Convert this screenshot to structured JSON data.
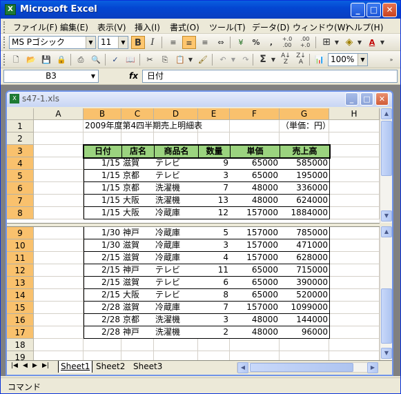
{
  "app": {
    "title": "Microsoft Excel"
  },
  "menubar": {
    "items": [
      "ファイル(F)",
      "編集(E)",
      "表示(V)",
      "挿入(I)",
      "書式(O)",
      "ツール(T)",
      "データ(D)",
      "ウィンドウ(W)",
      "ヘルプ(H)"
    ]
  },
  "format_toolbar": {
    "font_name": "MS Pゴシック",
    "font_size": "11",
    "bold_label": "B",
    "italic_label": "I",
    "percent_label": "%",
    "comma_label": ",",
    "inc_dec_label": "+.0 .00",
    "dec_dec_label": ".00 +.0"
  },
  "standard_toolbar": {
    "zoom": "100%",
    "sum_label": "Σ"
  },
  "formula_bar": {
    "name_box": "B3",
    "fx_label": "fx",
    "content": "日付"
  },
  "workbook": {
    "title": "s47-1.xls"
  },
  "columns": [
    "A",
    "B",
    "C",
    "D",
    "E",
    "F",
    "G",
    "H"
  ],
  "row_numbers_top": [
    "1",
    "2",
    "3",
    "4",
    "5",
    "6",
    "7",
    "8"
  ],
  "row_numbers_bottom": [
    "9",
    "10",
    "11",
    "12",
    "13",
    "14",
    "15",
    "16",
    "17",
    "18",
    "19"
  ],
  "sheet": {
    "title_cell": "2009年度第4四半期売上明細表",
    "unit_cell": "（単価：円）",
    "headers": [
      "日付",
      "店名",
      "商品名",
      "数量",
      "単価",
      "売上高"
    ],
    "rows_top": [
      [
        "1/15",
        "滋賀",
        "テレビ",
        "9",
        "65000",
        "585000"
      ],
      [
        "1/15",
        "京都",
        "テレビ",
        "3",
        "65000",
        "195000"
      ],
      [
        "1/15",
        "京都",
        "洗濯機",
        "7",
        "48000",
        "336000"
      ],
      [
        "1/15",
        "大阪",
        "洗濯機",
        "13",
        "48000",
        "624000"
      ],
      [
        "1/15",
        "大阪",
        "冷蔵庫",
        "12",
        "157000",
        "1884000"
      ]
    ],
    "rows_bottom": [
      [
        "1/30",
        "神戸",
        "冷蔵庫",
        "5",
        "157000",
        "785000"
      ],
      [
        "1/30",
        "滋賀",
        "冷蔵庫",
        "3",
        "157000",
        "471000"
      ],
      [
        "2/15",
        "滋賀",
        "冷蔵庫",
        "4",
        "157000",
        "628000"
      ],
      [
        "2/15",
        "神戸",
        "テレビ",
        "11",
        "65000",
        "715000"
      ],
      [
        "2/15",
        "滋賀",
        "テレビ",
        "6",
        "65000",
        "390000"
      ],
      [
        "2/15",
        "大阪",
        "テレビ",
        "8",
        "65000",
        "520000"
      ],
      [
        "2/28",
        "滋賀",
        "冷蔵庫",
        "7",
        "157000",
        "1099000"
      ],
      [
        "2/28",
        "京都",
        "洗濯機",
        "3",
        "48000",
        "144000"
      ],
      [
        "2/28",
        "神戸",
        "洗濯機",
        "2",
        "48000",
        "96000"
      ]
    ]
  },
  "sheet_tabs": [
    "Sheet1",
    "Sheet2",
    "Sheet3"
  ],
  "status": {
    "mode": "コマンド"
  },
  "colors": {
    "selection_header": "#f9c16d",
    "table_header_fill": "#9bd37f",
    "title_bar": "#0346d2"
  }
}
